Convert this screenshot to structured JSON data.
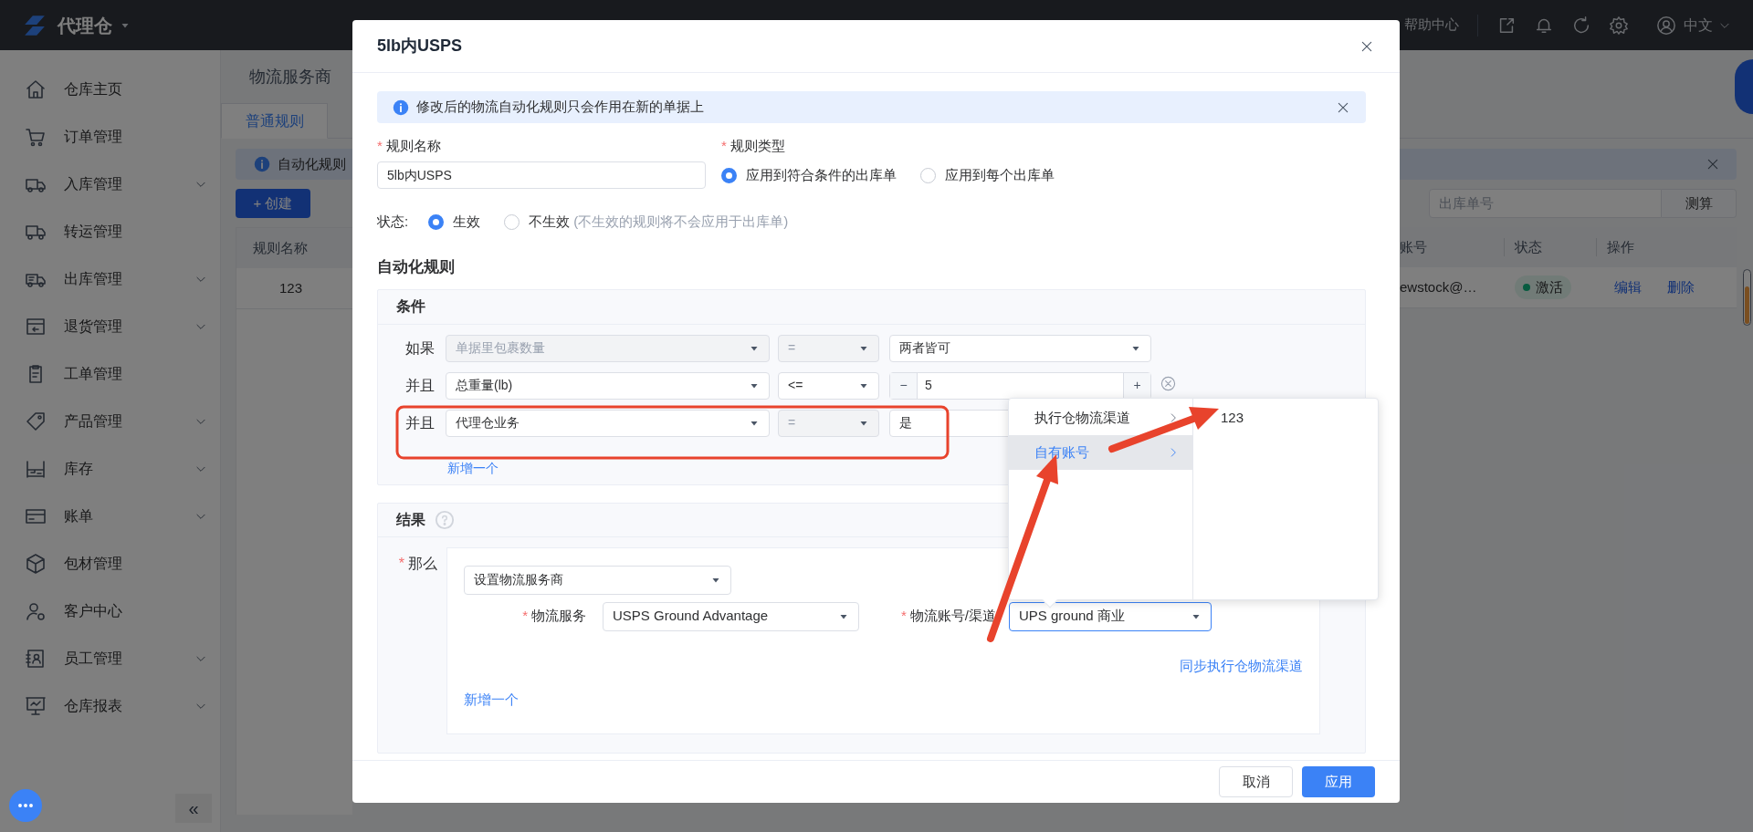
{
  "top_bar": {
    "app_name": "代理仓",
    "help_link": "帮助中心",
    "language": "中文"
  },
  "sidebar": {
    "items": [
      {
        "label": "仓库主页",
        "expandable": false,
        "selected": false
      },
      {
        "label": "订单管理",
        "expandable": false,
        "selected": false
      },
      {
        "label": "入库管理",
        "expandable": true,
        "selected": false
      },
      {
        "label": "转运管理",
        "expandable": false,
        "selected": false
      },
      {
        "label": "出库管理",
        "expandable": true,
        "selected": false
      },
      {
        "label": "退货管理",
        "expandable": true,
        "selected": false
      },
      {
        "label": "工单管理",
        "expandable": false,
        "selected": false
      },
      {
        "label": "产品管理",
        "expandable": true,
        "selected": false
      },
      {
        "label": "库存",
        "expandable": true,
        "selected": false
      },
      {
        "label": "账单",
        "expandable": true,
        "selected": false
      },
      {
        "label": "包材管理",
        "expandable": false,
        "selected": false
      },
      {
        "label": "客户中心",
        "expandable": false,
        "selected": false
      },
      {
        "label": "员工管理",
        "expandable": true,
        "selected": false
      },
      {
        "label": "仓库报表",
        "expandable": true,
        "selected": false
      }
    ],
    "collapse_button": "«"
  },
  "page": {
    "title": "物流服务商",
    "tabs": [
      {
        "label": "普通规则",
        "selected": true
      }
    ],
    "alert": "自动化规则",
    "create_button": "+ 创建",
    "search": {
      "placeholder": "出库单号",
      "button": "测算"
    },
    "table": {
      "columns": [
        "规则名称",
        "账号",
        "状态",
        "操作"
      ],
      "rows": [
        {
          "name": "123",
          "account": "ewstock@…",
          "status": "激活",
          "actions": [
            "编辑",
            "删除"
          ]
        }
      ]
    }
  },
  "modal": {
    "title": "5lb内USPS",
    "notice": "修改后的物流自动化规则只会作用在新的单据上",
    "rule_name": {
      "required_mark": "*",
      "label": "规则名称",
      "value": "5lb内USPS"
    },
    "rule_type": {
      "required_mark": "*",
      "label": "规则类型",
      "options": [
        {
          "label": "应用到符合条件的出库单",
          "selected": true
        },
        {
          "label": "应用到每个出库单",
          "selected": false
        }
      ]
    },
    "status": {
      "label": "状态:",
      "options": [
        {
          "label": "生效",
          "selected": true
        },
        {
          "label": "不生效",
          "selected": false,
          "note": "(不生效的规则将不会应用于出库单)"
        }
      ]
    },
    "section_title": "自动化规则",
    "conditions": {
      "title": "条件",
      "rows": [
        {
          "connector": "如果",
          "field": {
            "value": "单据里包裹数量",
            "disabled": true
          },
          "operator": {
            "value": "=",
            "disabled": true
          },
          "value": {
            "kind": "select",
            "value": "两者皆可"
          }
        },
        {
          "connector": "并且",
          "field": {
            "value": "总重量(lb)",
            "disabled": false
          },
          "operator": {
            "value": "<=",
            "disabled": false
          },
          "value": {
            "kind": "number",
            "value": "5",
            "minus": "−",
            "plus": "+"
          },
          "removable": true
        },
        {
          "connector": "并且",
          "field": {
            "value": "代理仓业务",
            "disabled": false
          },
          "operator": {
            "value": "=",
            "disabled": true
          },
          "value": {
            "kind": "select",
            "value": "是"
          }
        }
      ],
      "add_link": "新增一个"
    },
    "results": {
      "title": "结果",
      "then_required_mark": "*",
      "then_label": "那么",
      "action": {
        "value": "设置物流服务商"
      },
      "service": {
        "required_mark": "*",
        "label": "物流服务",
        "value": "USPS Ground Advantage",
        "focused": false
      },
      "account": {
        "required_mark": "*",
        "label": "物流账号/渠道",
        "value": "UPS ground 商业",
        "focused": true
      },
      "sync_link": "同步执行仓物流渠道",
      "add_link": "新增一个"
    },
    "buttons": [
      {
        "label": "取消",
        "kind": "default"
      },
      {
        "label": "应用",
        "kind": "primary"
      }
    ]
  },
  "cascader": {
    "columns": [
      [
        {
          "label": "执行仓物流渠道",
          "selected": false,
          "has_children": true
        },
        {
          "label": "自有账号",
          "selected": true,
          "has_children": true
        }
      ],
      [
        {
          "label": "123",
          "selected": false,
          "has_children": false
        }
      ]
    ]
  }
}
